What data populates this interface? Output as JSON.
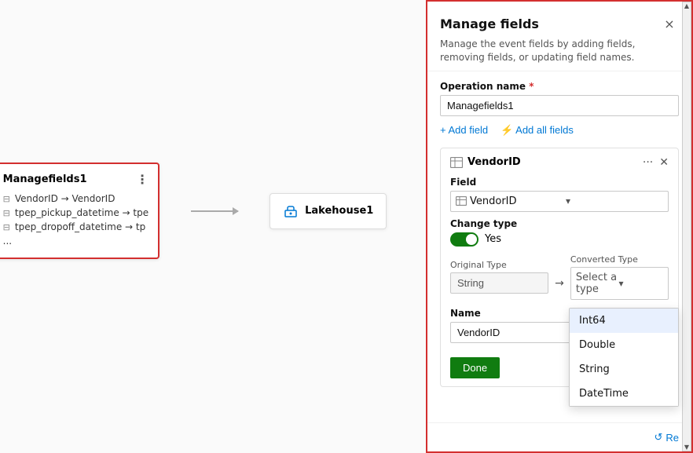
{
  "canvas": {
    "node1": {
      "title": "Managefields1",
      "rows": [
        "VendorID → VendorID",
        "tpep_pickup_datetime → tpe",
        "tpep_dropoff_datetime → tp"
      ],
      "more": "..."
    },
    "node2": {
      "title": "Lakehouse1"
    }
  },
  "panel": {
    "title": "Manage fields",
    "description": "Manage the event fields by adding fields, removing fields, or updating field names.",
    "close_label": "×",
    "operation_label": "Operation name",
    "operation_value": "Managefields1",
    "add_field_label": "+ Add field",
    "add_all_fields_label": "⚡ Add all fields",
    "field_card": {
      "title": "VendorID",
      "field_label": "Field",
      "field_value": "VendorID",
      "change_type_label": "Change type",
      "change_type_value": "Yes",
      "original_type_label": "Original Type",
      "original_type_value": "String",
      "converted_type_label": "Converted Type",
      "converted_type_placeholder": "Select a type",
      "name_label": "Name",
      "name_value": "VendorID",
      "done_label": "Done"
    },
    "dropdown_options": [
      "Int64",
      "Double",
      "String",
      "DateTime"
    ],
    "footer": {
      "reset_label": "Re"
    }
  }
}
